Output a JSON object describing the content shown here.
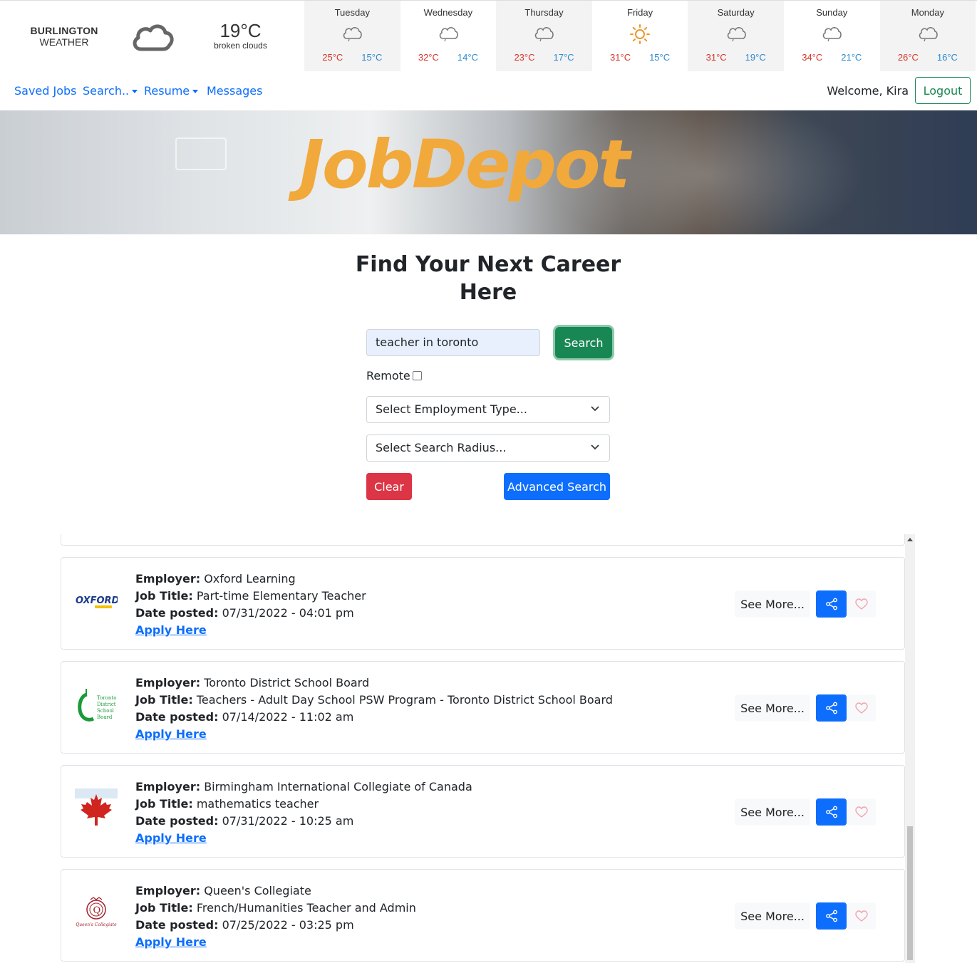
{
  "weather": {
    "city": "BURLINGTON",
    "label": "WEATHER",
    "current": {
      "temp": "19°C",
      "desc": "broken clouds",
      "icon": "cloud-icon"
    },
    "days": [
      {
        "name": "Tuesday",
        "icon": "cloud-rain-icon",
        "hi": "25°C",
        "lo": "15°C"
      },
      {
        "name": "Wednesday",
        "icon": "cloud-rain-icon",
        "hi": "32°C",
        "lo": "14°C"
      },
      {
        "name": "Thursday",
        "icon": "cloud-rain-icon",
        "hi": "23°C",
        "lo": "17°C"
      },
      {
        "name": "Friday",
        "icon": "sun-icon",
        "hi": "31°C",
        "lo": "15°C"
      },
      {
        "name": "Saturday",
        "icon": "cloud-rain-icon",
        "hi": "31°C",
        "lo": "19°C"
      },
      {
        "name": "Sunday",
        "icon": "cloud-rain-icon",
        "hi": "34°C",
        "lo": "21°C"
      },
      {
        "name": "Monday",
        "icon": "cloud-rain-icon",
        "hi": "26°C",
        "lo": "16°C"
      }
    ]
  },
  "nav": {
    "saved_jobs": "Saved Jobs",
    "search": "Search..",
    "resume": "Resume",
    "messages": "Messages",
    "welcome": "Welcome, Kira",
    "logout": "Logout"
  },
  "banner": {
    "logo_text": "JobDepot"
  },
  "search": {
    "heading_line1": "Find Your Next Career",
    "heading_line2": "Here",
    "query": "teacher in toronto",
    "search_button": "Search",
    "remote_label": "Remote",
    "remote_checked": false,
    "employment_type": "Select Employment Type...",
    "search_radius": "Select Search Radius...",
    "clear_button": "Clear",
    "advanced_button": "Advanced Search"
  },
  "labels": {
    "employer": "Employer:",
    "job_title": "Job Title:",
    "date_posted": "Date posted:",
    "apply": "Apply Here",
    "see_more": "See More..."
  },
  "jobs": [
    {
      "employer": "Oxford Learning",
      "title": "Part-time Elementary Teacher",
      "date": "07/31/2022 - 04:01 pm",
      "logo": "oxford-learning-logo"
    },
    {
      "employer": "Toronto District School Board",
      "title": "Teachers - Adult Day School PSW Program - Toronto District School Board",
      "date": "07/14/2022 - 11:02 am",
      "logo": "tdsb-logo"
    },
    {
      "employer": "Birmingham International Collegiate of Canada",
      "title": "mathematics teacher",
      "date": "07/31/2022 - 10:25 am",
      "logo": "maple-leaf-logo"
    },
    {
      "employer": "Queen's Collegiate",
      "title": "French/Humanities Teacher and Admin",
      "date": "07/25/2022 - 03:25 pm",
      "logo": "queens-collegiate-logo"
    }
  ],
  "logo_text": {
    "oxford": "OXFORD",
    "tdsb": [
      "Toronto",
      "District",
      "School",
      "Board"
    ],
    "queens": "Queen's Collegiate"
  },
  "colors": {
    "primary": "#0d6efd",
    "success": "#198754",
    "danger": "#dc3545",
    "logo_orange": "#f2a93b",
    "temp_hi": "#d9342b",
    "temp_lo": "#2b8ad1"
  }
}
